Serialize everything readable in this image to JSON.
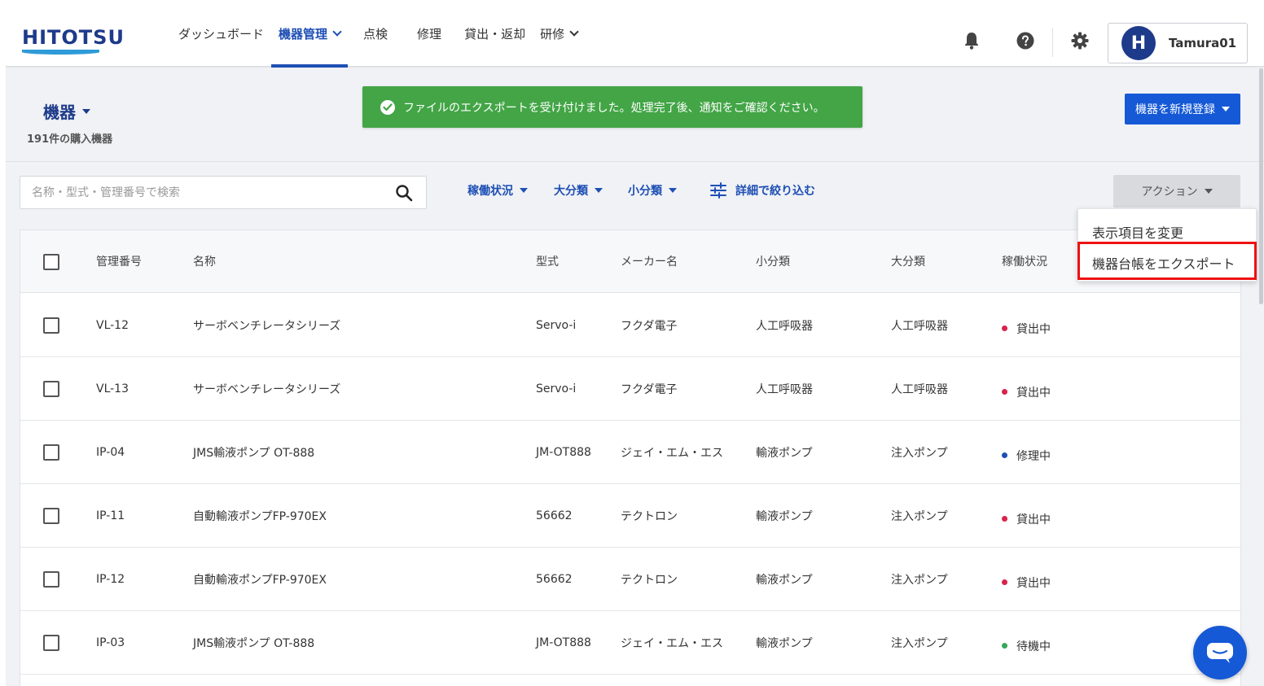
{
  "brand": {
    "logo_text": "HITOTSU"
  },
  "nav": {
    "items": [
      {
        "label": "ダッシュボード",
        "active": false,
        "dropdown": false
      },
      {
        "label": "機器管理",
        "active": true,
        "dropdown": true
      },
      {
        "label": "点検",
        "active": false,
        "dropdown": false
      },
      {
        "label": "修理",
        "active": false,
        "dropdown": false
      },
      {
        "label": "貸出・返却",
        "active": false,
        "dropdown": false
      },
      {
        "label": "研修",
        "active": false,
        "dropdown": true
      }
    ]
  },
  "header_icons": [
    "bell-icon",
    "help-icon",
    "gear-icon"
  ],
  "user": {
    "initial": "H",
    "name": "Tamura01"
  },
  "page": {
    "title": "機器",
    "count_text": "191件の購入機器"
  },
  "toast": {
    "message": "ファイルのエクスポートを受け付けました。処理完了後、通知をご確認ください。"
  },
  "register_button": {
    "label": "機器を新規登録"
  },
  "search": {
    "placeholder": "名称・型式・管理番号で検索",
    "value": ""
  },
  "filters": {
    "status": "稼働状況",
    "major": "大分類",
    "minor": "小分類",
    "detail": "詳細で絞り込む"
  },
  "action_button": {
    "label": "アクション"
  },
  "action_menu": {
    "items": [
      "表示項目を変更",
      "機器台帳をエクスポート"
    ],
    "highlighted_index": 1
  },
  "table": {
    "columns": [
      "管理番号",
      "名称",
      "型式",
      "メーカー名",
      "小分類",
      "大分類",
      "稼働状況"
    ],
    "rows": [
      {
        "id": "VL-12",
        "name": "サーボベンチレータシリーズ",
        "model": "Servo-i",
        "maker": "フクダ電子",
        "minor": "人工呼吸器",
        "major": "人工呼吸器",
        "status": "貸出中",
        "status_color": "#d9224b"
      },
      {
        "id": "VL-13",
        "name": "サーボベンチレータシリーズ",
        "model": "Servo-i",
        "maker": "フクダ電子",
        "minor": "人工呼吸器",
        "major": "人工呼吸器",
        "status": "貸出中",
        "status_color": "#d9224b"
      },
      {
        "id": "IP-04",
        "name": "JMS輸液ポンプ OT-888",
        "model": "JM-OT888",
        "maker": "ジェイ・エム・エス",
        "minor": "輸液ポンプ",
        "major": "注入ポンプ",
        "status": "修理中",
        "status_color": "#1e4fb4"
      },
      {
        "id": "IP-11",
        "name": "自動輸液ポンプFP-970EX",
        "model": "56662",
        "maker": "テクトロン",
        "minor": "輸液ポンプ",
        "major": "注入ポンプ",
        "status": "貸出中",
        "status_color": "#d9224b"
      },
      {
        "id": "IP-12",
        "name": "自動輸液ポンプFP-970EX",
        "model": "56662",
        "maker": "テクトロン",
        "minor": "輸液ポンプ",
        "major": "注入ポンプ",
        "status": "貸出中",
        "status_color": "#d9224b"
      },
      {
        "id": "IP-03",
        "name": "JMS輸液ポンプ OT-888",
        "model": "JM-OT888",
        "maker": "ジェイ・エム・エス",
        "minor": "輸液ポンプ",
        "major": "注入ポンプ",
        "status": "待機中",
        "status_color": "#3aa55a"
      }
    ]
  },
  "colors": {
    "brand_navy": "#1e3a8a",
    "accent_blue": "#1559d6",
    "toast_green": "#43a546",
    "highlight_red": "#e11111"
  }
}
